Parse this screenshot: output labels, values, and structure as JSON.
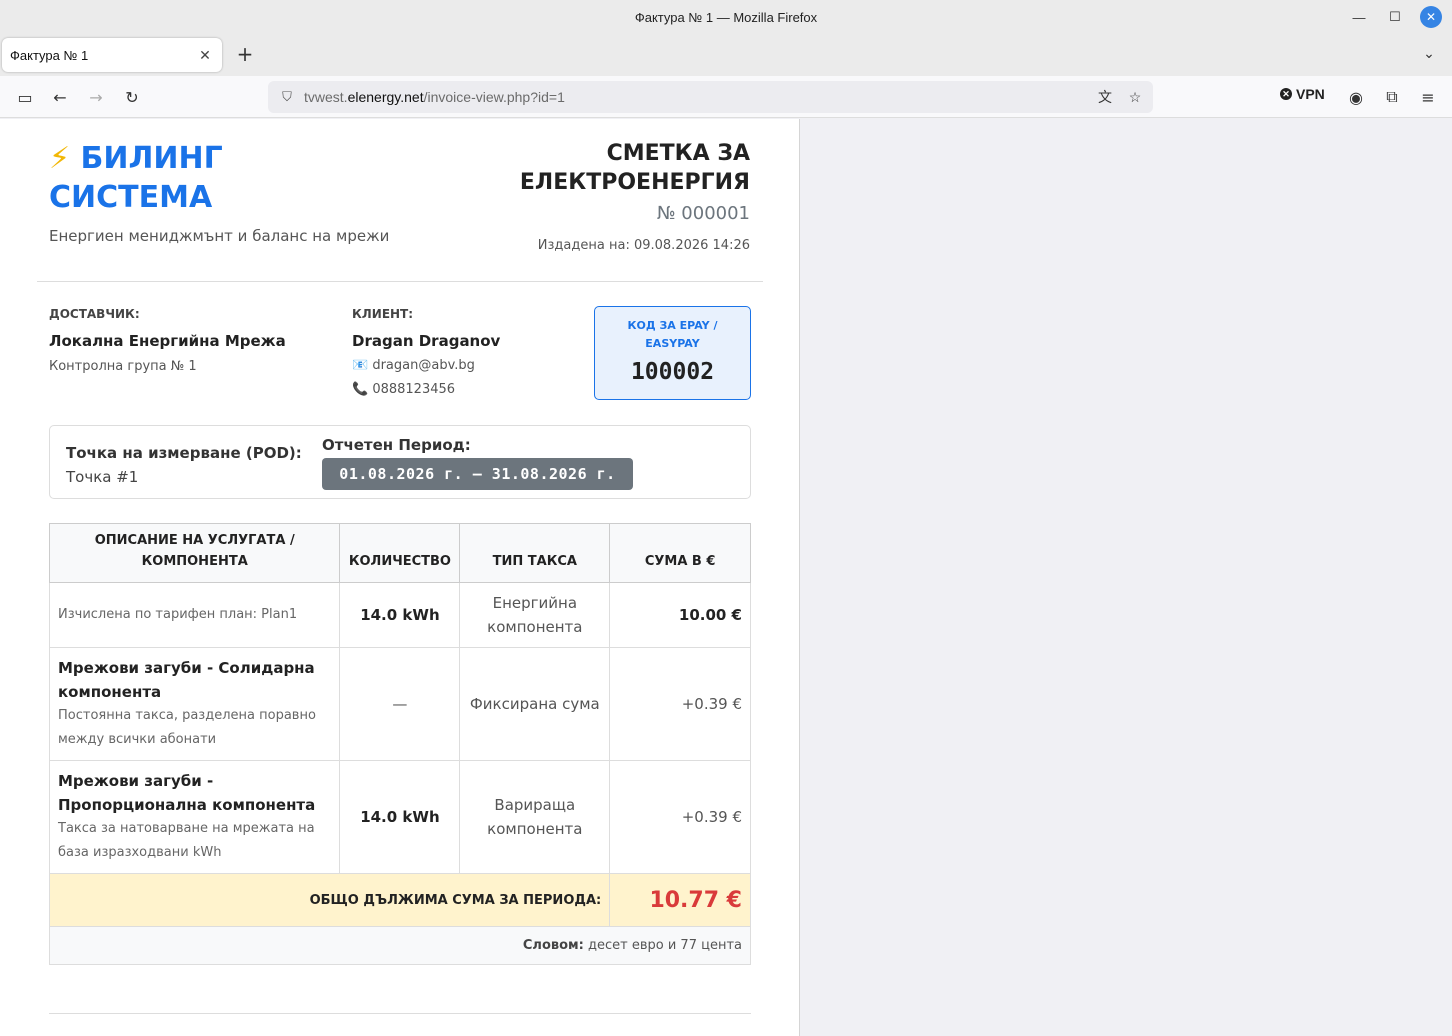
{
  "window": {
    "title": "Фактура № 1 — Mozilla Firefox"
  },
  "tab": {
    "title": "Фактура № 1"
  },
  "navbar": {
    "url_prefix": "tvwest.",
    "url_host": "elenergy.net",
    "url_path": "/invoice-view.php?id=1",
    "vpn_label": "VPN"
  },
  "brand": {
    "bolt": "⚡",
    "name_line1": "БИЛИНГ",
    "name_line2": "СИСТЕМА",
    "tagline": "Енергиен мениджмънт и баланс на мрежи"
  },
  "document": {
    "title_line1": "СМЕТКА ЗА",
    "title_line2": "ЕЛЕКТРОЕНЕРГИЯ",
    "number": "№ 000001",
    "issued_label": "Издадена на:",
    "issued_value": "09.08.2026 14:26"
  },
  "supplier": {
    "label": "ДОСТАВЧИК:",
    "name": "Локална Енергийна Мрежа",
    "group": "Контролна група № 1"
  },
  "client": {
    "label": "КЛИЕНТ:",
    "name": "Dragan Draganov",
    "email_icon": "📧",
    "email": "dragan@abv.bg",
    "phone_icon": "📞",
    "phone": "0888123456"
  },
  "epay": {
    "label": "КОД ЗА EPAY / EASYPAY",
    "code": "100002"
  },
  "pod": {
    "label": "Точка на измерване (POD):",
    "value": "Точка #1",
    "period_label": "Отчетен Период:",
    "period_value": "01.08.2026 г. – 31.08.2026 г."
  },
  "table": {
    "headers": {
      "desc": "ОПИСАНИЕ НА УСЛУГАТА / КОМПОНЕНТА",
      "qty": "КОЛИЧЕСТВО",
      "type": "ТИП ТАКСА",
      "amount": "СУМА В €"
    },
    "rows": [
      {
        "title": "",
        "desc": "Изчислена по тарифен план: Plan1",
        "qty": "14.0 kWh",
        "type": "Енергийна компонента",
        "amount": "10.00 €"
      },
      {
        "title": "Мрежови загуби - Солидарна компонента",
        "desc": "Постоянна такса, разделена поравно между всички абонати",
        "qty": "—",
        "type": "Фиксирана сума",
        "amount": "+0.39 €"
      },
      {
        "title": "Мрежови загуби - Пропорционална компонента",
        "desc": "Такса за натоварване на мрежата на база изразходвани kWh",
        "qty": "14.0 kWh",
        "type": "Варираща компонента",
        "amount": "+0.39 €"
      }
    ],
    "total_label": "ОБЩО ДЪЛЖИМА СУМА ЗА ПЕРИОДА:",
    "total_amount": "10.77 €",
    "words_label": "Словом:",
    "words_value": "десет евро и 77 цента"
  }
}
